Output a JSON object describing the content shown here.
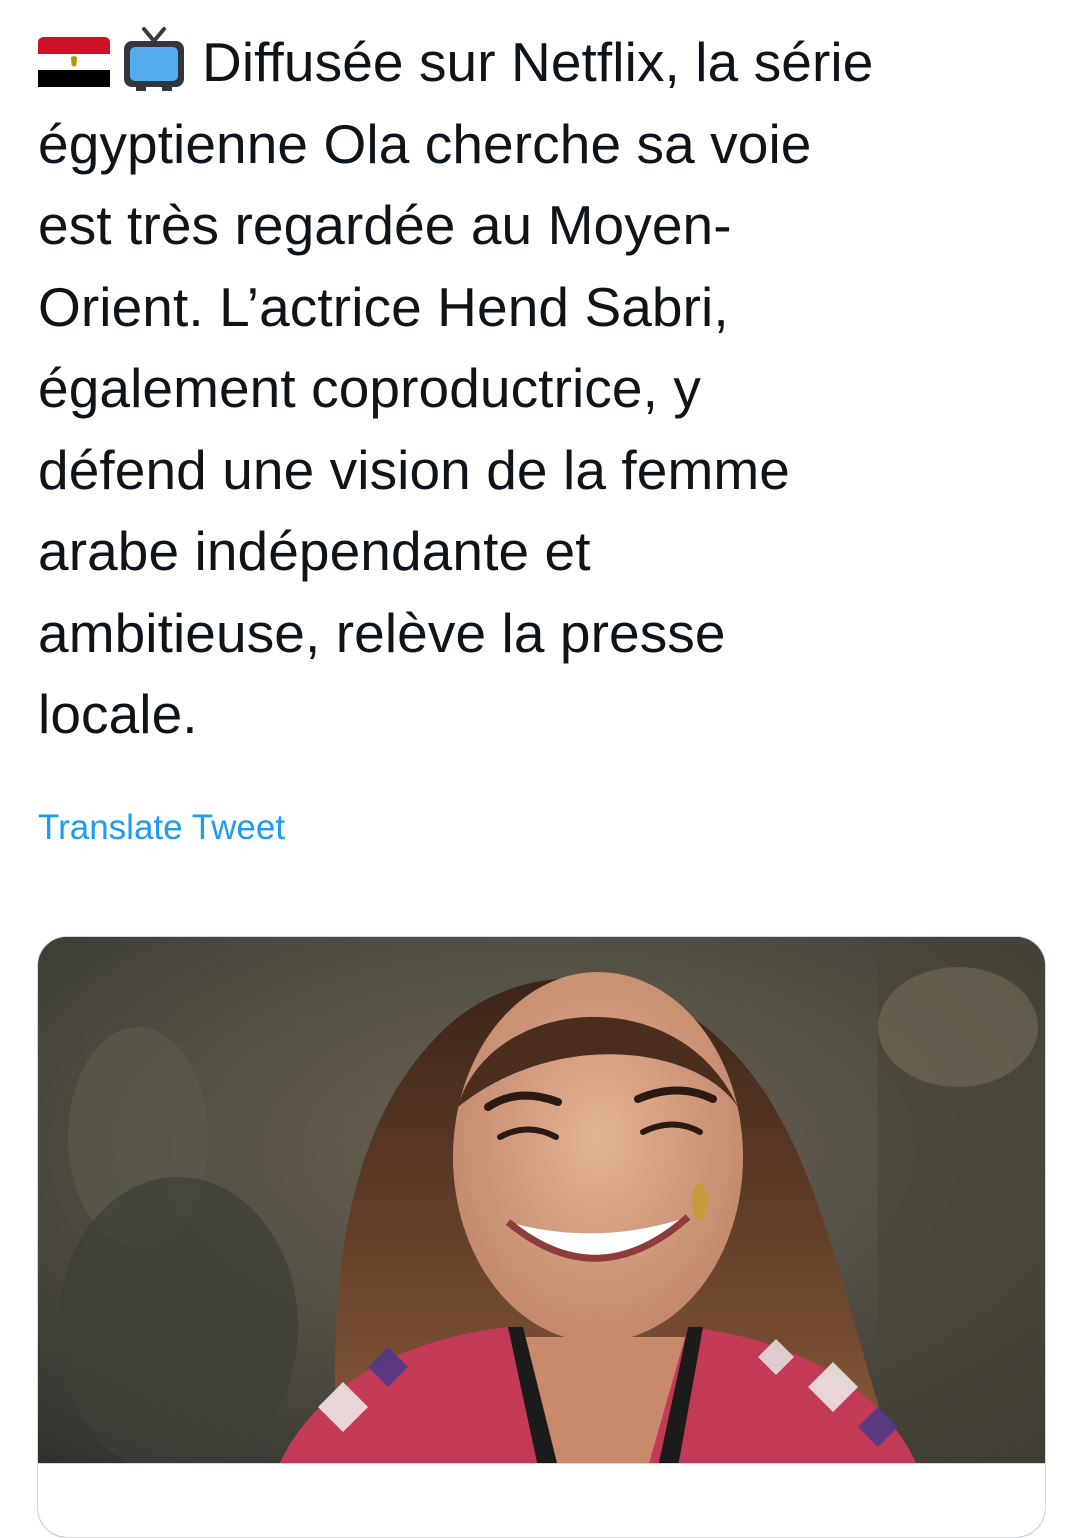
{
  "tweet": {
    "emojis": [
      "egypt-flag",
      "television"
    ],
    "lines": [
      "Diffusée sur Netflix, la série",
      "égyptienne Ola cherche sa voie",
      "est très regardée au Moyen-",
      "Orient. L’actrice Hend Sabri,",
      "également coproductrice, y",
      "défend une vision de la femme",
      "arabe indépendante et",
      "ambitieuse, relève la presse",
      "locale."
    ],
    "translate_label": "Translate Tweet"
  },
  "media": {
    "type": "photo",
    "icon": "photo-of-smiling-woman"
  },
  "colors": {
    "text": "#0f1419",
    "link": "#1d9bf0",
    "border": "#cfd9de",
    "background": "#ffffff"
  }
}
